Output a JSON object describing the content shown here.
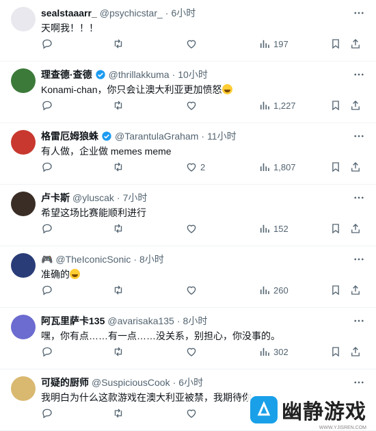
{
  "tweets": [
    {
      "name": "sealstaaarr_",
      "verified": false,
      "handle": "@psychicstar_",
      "time": "6小时",
      "text": "天啊我！！！",
      "emoji": false,
      "stats": {
        "replies": "",
        "retweets": "",
        "likes": "",
        "views": "197"
      },
      "avatar_color": "#e8e8ee"
    },
    {
      "name": "理查德·查德",
      "verified": true,
      "handle": "@thrillakkuma",
      "time": "10小时",
      "text": "Konami-chan，你只会让澳大利亚更加愤怒",
      "emoji": true,
      "stats": {
        "replies": "",
        "retweets": "",
        "likes": "",
        "views": "1,227"
      },
      "avatar_color": "#3c7a3a"
    },
    {
      "name": "格雷厄姆狼蛛",
      "verified": true,
      "handle": "@TarantulaGraham",
      "time": "11小时",
      "text": "有人做，企业做 memes meme",
      "emoji": false,
      "stats": {
        "replies": "",
        "retweets": "",
        "likes": "2",
        "views": "1,807"
      },
      "avatar_color": "#c8382e"
    },
    {
      "name": "卢卡斯",
      "verified": false,
      "handle": "@yluscak",
      "time": "7小时",
      "text": "希望这场比赛能顺利进行",
      "emoji": false,
      "stats": {
        "replies": "",
        "retweets": "",
        "likes": "",
        "views": "152"
      },
      "avatar_color": "#3a2d26"
    },
    {
      "name": "🎮",
      "verified": false,
      "handle": "@TheIconicSonic",
      "time": "8小时",
      "text": "准确的",
      "emoji": true,
      "stats": {
        "replies": "",
        "retweets": "",
        "likes": "",
        "views": "260"
      },
      "avatar_color": "#2a3c78"
    },
    {
      "name": "阿瓦里萨卡135",
      "verified": false,
      "handle": "@avarisaka135",
      "time": "8小时",
      "text": "嘿，你有点……有一点……没关系，别担心，你没事的。",
      "emoji": false,
      "stats": {
        "replies": "",
        "retweets": "",
        "likes": "",
        "views": "302"
      },
      "avatar_color": "#6b6bd0"
    },
    {
      "name": "可疑的厨师",
      "verified": false,
      "handle": "@SuspiciousCook",
      "time": "6小时",
      "text": "我明白为什么这款游戏在澳大利亚被禁，我期待你",
      "emoji": false,
      "stats": {
        "replies": "",
        "retweets": "",
        "likes": "",
        "views": ""
      },
      "avatar_color": "#d9b870"
    }
  ],
  "separator": "·",
  "watermark": {
    "text": "幽静游戏",
    "url": "WWW.YJISREN.COM"
  },
  "colors": {
    "accent": "#1d9bf0",
    "muted": "#536471",
    "border": "#eff3f4"
  }
}
